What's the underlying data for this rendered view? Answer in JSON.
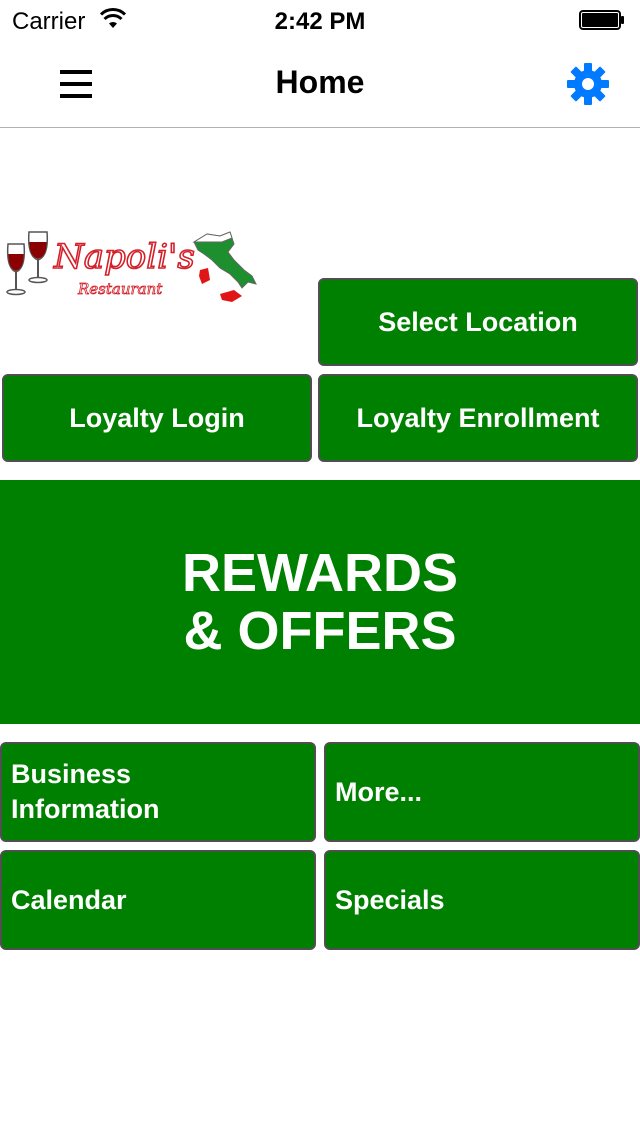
{
  "status_bar": {
    "carrier": "Carrier",
    "time": "2:42 PM",
    "icons": [
      "wifi-icon",
      "battery-icon"
    ]
  },
  "nav": {
    "title": "Home",
    "left_icon": "hamburger-menu-icon",
    "right_icon": "gear-icon",
    "accent_color": "#007aff"
  },
  "logo": {
    "brand": "Napoli's",
    "subtitle": "Restaurant"
  },
  "buttons": {
    "select_location": "Select Location",
    "loyalty_login": "Loyalty Login",
    "loyalty_enrollment": "Loyalty Enrollment",
    "rewards_line1": "REWARDS",
    "rewards_line2": "& OFFERS",
    "business_info_line1": "Business",
    "business_info_line2": "Information",
    "more": "More...",
    "calendar": "Calendar",
    "specials": "Specials"
  },
  "colors": {
    "button_green": "#008000",
    "button_border": "#4f4f4f",
    "text_white": "#ffffff"
  }
}
